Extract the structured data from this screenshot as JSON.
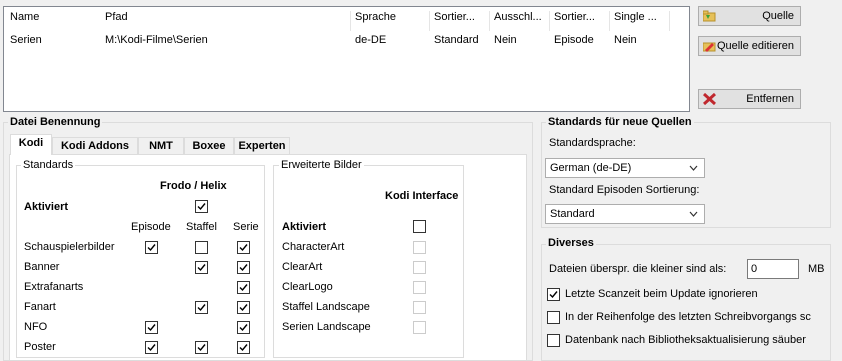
{
  "sources": {
    "columns": [
      "Name",
      "Pfad",
      "Sprache",
      "Sortier...",
      "Ausschl...",
      "Sortier...",
      "Single ..."
    ],
    "rows": [
      [
        "Serien",
        "M:\\Kodi-Filme\\Serien",
        "de-DE",
        "Standard",
        "Nein",
        "Episode",
        "Nein"
      ]
    ]
  },
  "buttons": {
    "add": "Quelle",
    "edit": "Quelle editieren",
    "remove": "Entfernen"
  },
  "naming": {
    "title": "Datei Benennung",
    "tabs": [
      "Kodi",
      "Kodi Addons",
      "NMT",
      "Boxee",
      "Experten"
    ],
    "standards": {
      "title": "Standards",
      "group_header": "Frodo / Helix",
      "activated_label": "Aktiviert",
      "activated": true,
      "col_episode": "Episode",
      "col_season": "Staffel",
      "col_series": "Serie",
      "rows": [
        {
          "label": "Schauspielerbilder",
          "episode": true,
          "season": false,
          "series": true
        },
        {
          "label": "Banner",
          "episode": null,
          "season": true,
          "series": true
        },
        {
          "label": "Extrafanarts",
          "episode": null,
          "season": null,
          "series": true
        },
        {
          "label": "Fanart",
          "episode": null,
          "season": true,
          "series": true
        },
        {
          "label": "NFO",
          "episode": true,
          "season": null,
          "series": true
        },
        {
          "label": "Poster",
          "episode": true,
          "season": true,
          "series": true
        }
      ]
    },
    "extended": {
      "title": "Erweiterte Bilder",
      "header": "Kodi Interface",
      "activated_label": "Aktiviert",
      "activated": false,
      "rows": [
        "CharacterArt",
        "ClearArt",
        "ClearLogo",
        "Staffel Landscape",
        "Serien Landscape"
      ]
    }
  },
  "defaults": {
    "title": "Standards für neue Quellen",
    "lang_label": "Standardsprache:",
    "lang_value": "German (de-DE)",
    "order_label": "Standard Episoden Sortierung:",
    "order_value": "Standard"
  },
  "misc": {
    "title": "Diverses",
    "skip_label": "Dateien überspr. die kleiner sind als:",
    "skip_value": "0",
    "skip_unit": "MB",
    "opt1": "Letzte Scanzeit beim Update ignorieren",
    "opt1_checked": true,
    "opt2": "In der Reihenfolge des letzten Schreibvorgangs sc",
    "opt2_checked": false,
    "opt3": "Datenbank nach Bibliotheksaktualisierung säuber",
    "opt3_checked": false
  }
}
